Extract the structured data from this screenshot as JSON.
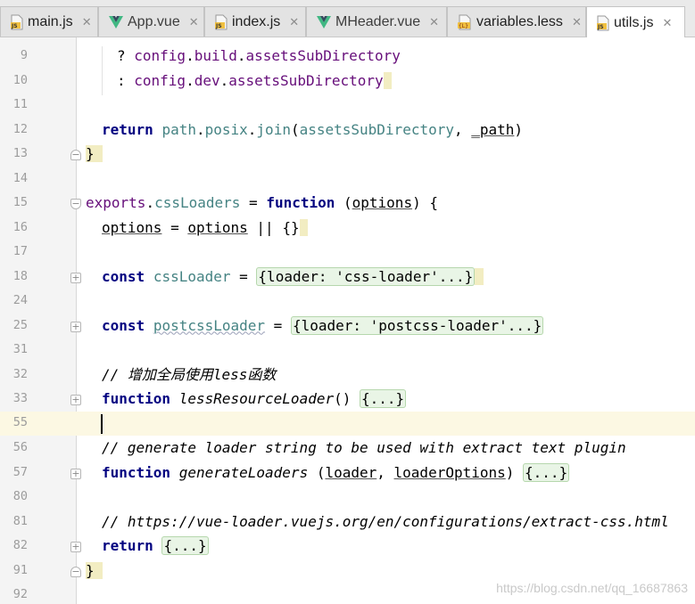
{
  "tabs": [
    {
      "label": "main.js",
      "icon": "js-file-icon",
      "active": false
    },
    {
      "label": "App.vue",
      "icon": "vue-file-icon",
      "active": false
    },
    {
      "label": "index.js",
      "icon": "js-file-icon",
      "active": false
    },
    {
      "label": "MHeader.vue",
      "icon": "vue-file-icon",
      "active": false
    },
    {
      "label": "variables.less",
      "icon": "less-file-icon",
      "active": false
    },
    {
      "label": "utils.js",
      "icon": "js-file-icon",
      "active": true
    }
  ],
  "close_glyph": "✕",
  "lines": [
    {
      "n": "9"
    },
    {
      "n": "10"
    },
    {
      "n": "11"
    },
    {
      "n": "12"
    },
    {
      "n": "13"
    },
    {
      "n": "14"
    },
    {
      "n": "15"
    },
    {
      "n": "16"
    },
    {
      "n": "17"
    },
    {
      "n": "18"
    },
    {
      "n": "24"
    },
    {
      "n": "25"
    },
    {
      "n": "31"
    },
    {
      "n": "32"
    },
    {
      "n": "33"
    },
    {
      "n": "55"
    },
    {
      "n": "56"
    },
    {
      "n": "57"
    },
    {
      "n": "80"
    },
    {
      "n": "81"
    },
    {
      "n": "82"
    },
    {
      "n": "91"
    },
    {
      "n": "92"
    }
  ],
  "code": {
    "l9_q": "? ",
    "l9_a": "config",
    "l9_b": "build",
    "l9_c": "assetsSubDirectory",
    "l10_q": ": ",
    "l10_a": "config",
    "l10_b": "dev",
    "l10_c": "assetsSubDirectory",
    "l12_kw": "return",
    "l12_a": "path",
    "l12_b": "posix",
    "l12_c": "join",
    "l12_d": "assetsSubDirectory",
    "l12_e": "_path",
    "l13_brace": "}",
    "l15_a": "exports",
    "l15_b": "cssLoaders",
    "l15_kw": "function",
    "l15_p": "options",
    "l16_a": "options",
    "l16_b": "options",
    "l16_c": "{}",
    "l18_kw": "const",
    "l18_id": "cssLoader",
    "l18_fold": "{loader: 'css-loader'...}",
    "l25_kw": "const",
    "l25_id": "postcssLoader",
    "l25_fold": "{loader: 'postcss-loader'...}",
    "l32_cmt": "// 增加全局使用less函数",
    "l33_kw": "function",
    "l33_fn": "lessResourceLoader",
    "l33_fold": "{...}",
    "l56_cmt": "// generate loader string to be used with extract text plugin",
    "l57_kw": "function",
    "l57_fn": "generateLoaders",
    "l57_p1": "loader",
    "l57_p2": "loaderOptions",
    "l57_fold": "{...}",
    "l81_cmt": "// https://vue-loader.vuejs.org/en/configurations/extract-css.html",
    "l82_kw": "return",
    "l82_fold": "{...}",
    "l91_brace": "}"
  },
  "watermark": "https://blog.csdn.net/qq_16687863",
  "colors": {
    "keyword": "#000080",
    "property": "#660e7a",
    "identifier": "#458383",
    "comment": "#808080",
    "string": "#008000",
    "current_line": "#fcf8e3",
    "vue_green": "#41b883",
    "js_yellow": "#f0c040"
  }
}
